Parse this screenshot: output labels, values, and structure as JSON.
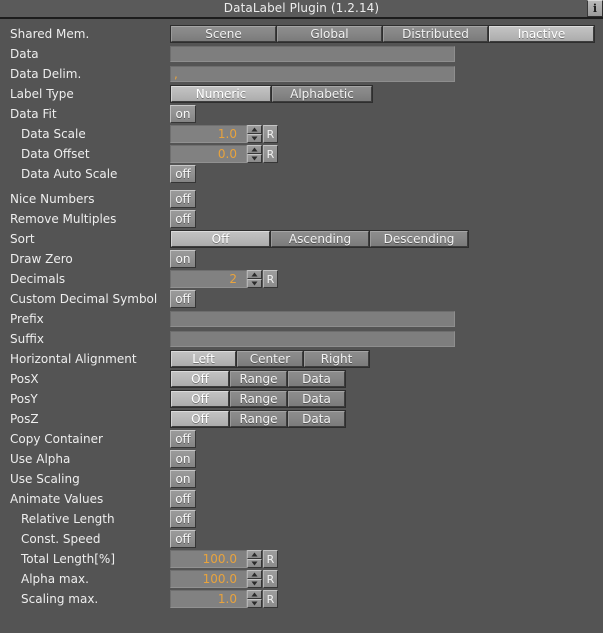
{
  "window": {
    "title": "DataLabel Plugin (1.2.14)",
    "info_icon": "info-icon",
    "info_label": "i"
  },
  "colors": {
    "background": "#545454",
    "titlebar": "#5a5a5a",
    "value_text": "#e8a33d",
    "button_face": "#868686",
    "button_active": "#b8b8b8",
    "field": "#7e7e7e"
  },
  "rows": {
    "shared_mem": {
      "label": "Shared Mem.",
      "options": [
        "Scene",
        "Global",
        "Distributed",
        "Inactive"
      ],
      "selected": "Inactive"
    },
    "data": {
      "label": "Data",
      "value": "",
      "placeholder": ""
    },
    "data_delim": {
      "label": "Data Delim.",
      "value": ",",
      "placeholder": ""
    },
    "label_type": {
      "label": "Label Type",
      "options": [
        "Numeric",
        "Alphabetic"
      ],
      "selected": "Numeric"
    },
    "data_fit": {
      "label": "Data Fit",
      "value": "on"
    },
    "data_scale": {
      "label": "Data Scale",
      "value": "1.0",
      "reset": "R"
    },
    "data_offset": {
      "label": "Data Offset",
      "value": "0.0",
      "reset": "R"
    },
    "data_auto_scale": {
      "label": "Data Auto Scale",
      "value": "off"
    },
    "nice_numbers": {
      "label": "Nice Numbers",
      "value": "off"
    },
    "remove_multiples": {
      "label": "Remove Multiples",
      "value": "off"
    },
    "sort": {
      "label": "Sort",
      "options": [
        "Off",
        "Ascending",
        "Descending"
      ],
      "selected": "Off"
    },
    "draw_zero": {
      "label": "Draw Zero",
      "value": "on"
    },
    "decimals": {
      "label": "Decimals",
      "value": "2",
      "reset": "R"
    },
    "custom_decimal_symbol": {
      "label": "Custom Decimal Symbol",
      "value": "off"
    },
    "prefix": {
      "label": "Prefix",
      "value": "",
      "placeholder": ""
    },
    "suffix": {
      "label": "Suffix",
      "value": "",
      "placeholder": ""
    },
    "horizontal_alignment": {
      "label": "Horizontal Alignment",
      "options": [
        "Left",
        "Center",
        "Right"
      ],
      "selected": "Left"
    },
    "pos_x": {
      "label": "PosX",
      "options": [
        "Off",
        "Range",
        "Data"
      ],
      "selected": "Off"
    },
    "pos_y": {
      "label": "PosY",
      "options": [
        "Off",
        "Range",
        "Data"
      ],
      "selected": "Off"
    },
    "pos_z": {
      "label": "PosZ",
      "options": [
        "Off",
        "Range",
        "Data"
      ],
      "selected": "Off"
    },
    "copy_container": {
      "label": "Copy Container",
      "value": "off"
    },
    "use_alpha": {
      "label": "Use Alpha",
      "value": "on"
    },
    "use_scaling": {
      "label": "Use Scaling",
      "value": "on"
    },
    "animate_values": {
      "label": "Animate Values",
      "value": "off"
    },
    "relative_length": {
      "label": "Relative Length",
      "value": "off"
    },
    "const_speed": {
      "label": "Const. Speed",
      "value": "off"
    },
    "total_length": {
      "label": "Total Length[%]",
      "value": "100.0",
      "reset": "R"
    },
    "alpha_max": {
      "label": "Alpha max.",
      "value": "100.0",
      "reset": "R"
    },
    "scaling_max": {
      "label": "Scaling max.",
      "value": "1.0",
      "reset": "R"
    }
  }
}
